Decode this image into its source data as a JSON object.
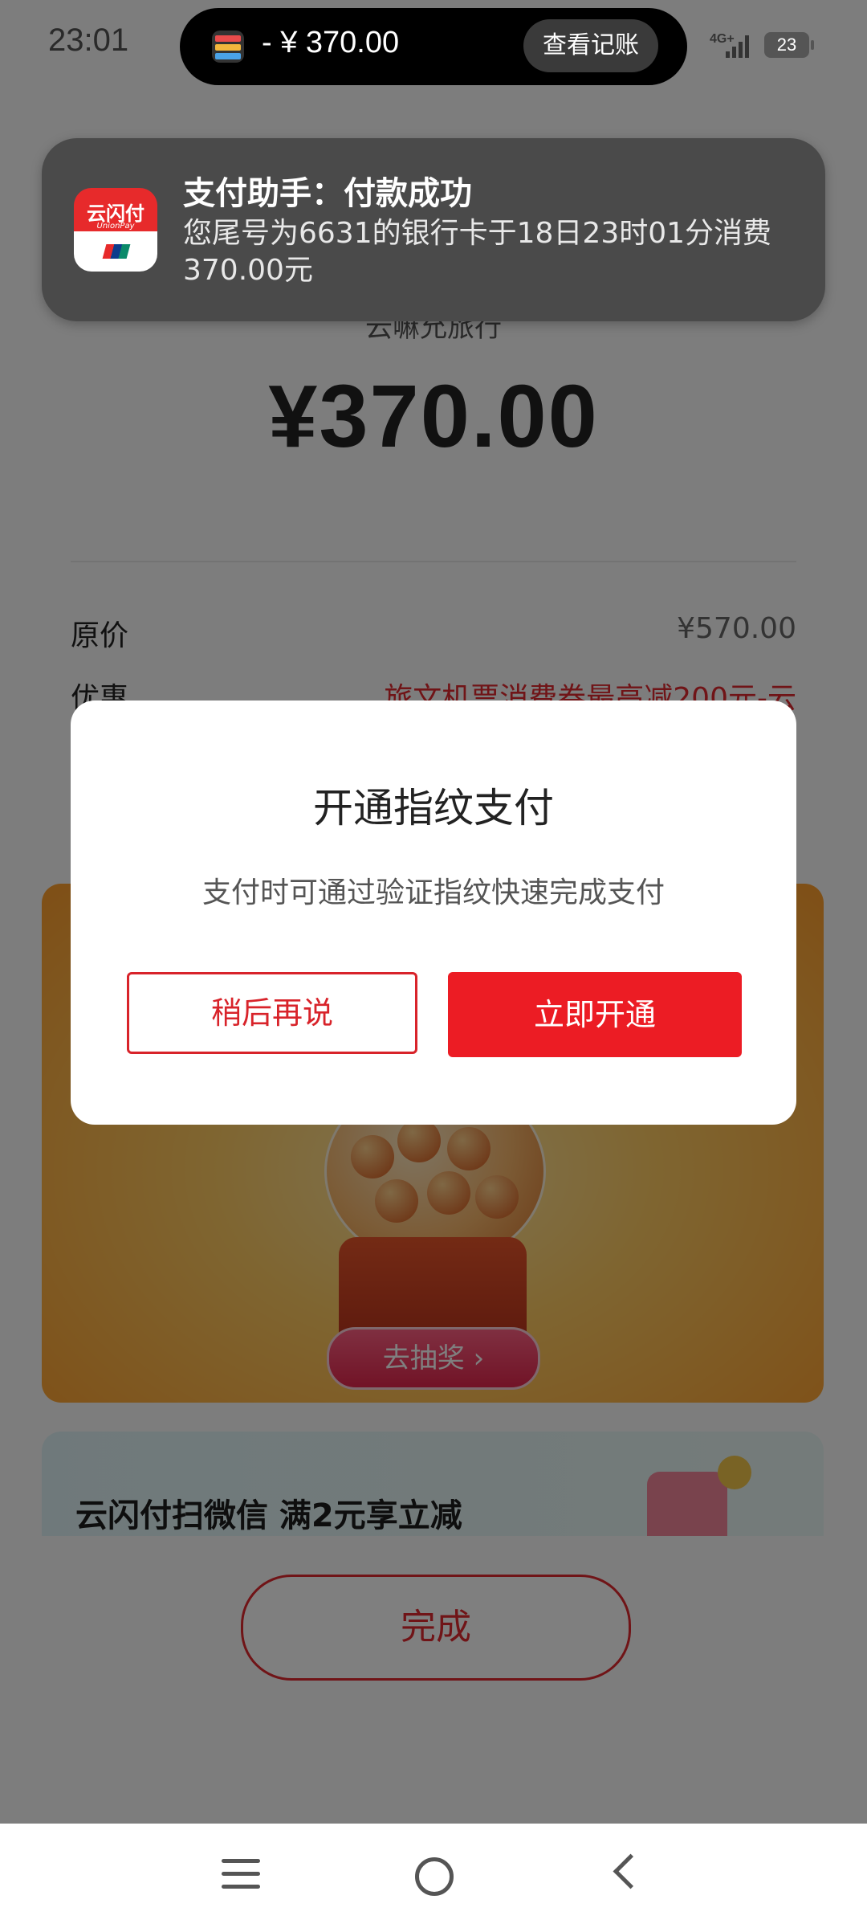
{
  "status_bar": {
    "time": "23:01",
    "network": "4G+",
    "battery": "23"
  },
  "island": {
    "amount": "- ¥ 370.00",
    "action_label": "查看记账"
  },
  "notification": {
    "title": "支付助手：付款成功",
    "body": "您尾号为6631的银行卡于18日23时01分消费370.00元",
    "app_icon_text": "云闪付",
    "app_icon_subtext": "UnionPay"
  },
  "page": {
    "merchant_partial": "云嘛允旅行",
    "amount": "¥370.00",
    "rows": [
      {
        "label": "原价",
        "value": "¥570.00"
      },
      {
        "label": "优惠",
        "value": "旅文机票消费券最高减200元-云"
      }
    ],
    "lottery_button": "去抽奖 ›",
    "wechat_promo": "云闪付扫微信 满2元享立减",
    "done_button": "完成"
  },
  "dialog": {
    "title": "开通指纹支付",
    "description": "支付时可通过验证指纹快速完成支付",
    "cancel_label": "稍后再说",
    "confirm_label": "立即开通"
  },
  "colors": {
    "brand_red": "#ec1c24",
    "notification_bg": "#4a4a4a",
    "island_bg": "#000000"
  },
  "icons": {
    "nav_menu": "menu-icon",
    "nav_home": "home-icon",
    "nav_back": "back-icon"
  }
}
